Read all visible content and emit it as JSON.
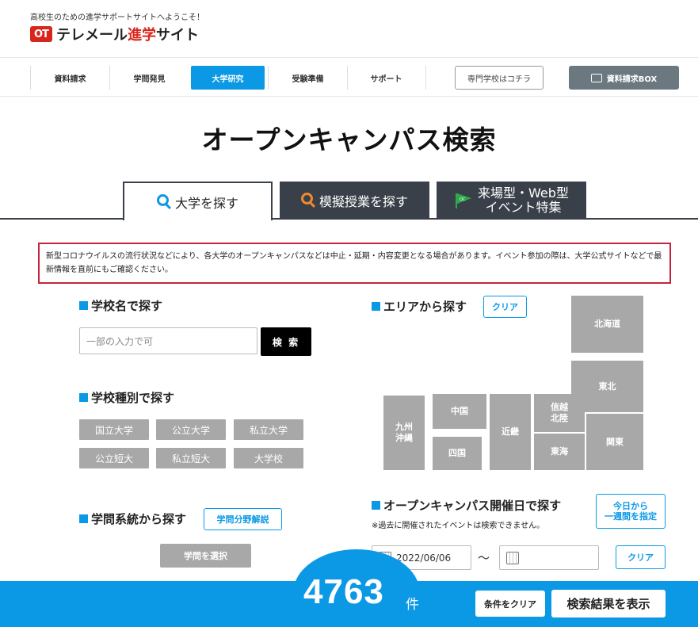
{
  "header": {
    "tagline": "高校生のための進学サポートサイトへようこそ！",
    "logo_mark": "OT",
    "logo_text_a": "テレメール",
    "logo_text_b": "進学",
    "logo_text_c": "サイト"
  },
  "nav": {
    "items": [
      {
        "label": "資料請求"
      },
      {
        "label": "学問発見"
      },
      {
        "label": "大学研究",
        "active": true
      },
      {
        "label": "受験準備"
      },
      {
        "label": "サポート"
      }
    ],
    "senmon_link": "専門学校はコチラ",
    "request_box": "資料請求BOX"
  },
  "page_title": "オープンキャンパス検索",
  "tabs": {
    "univ": "大学を探す",
    "mogi": "模擬授業を探す",
    "event_line1": "来場型・Web型",
    "event_line2": "イベント特集",
    "event_badge": "OC"
  },
  "notice": "新型コロナウイルスの流行状況などにより、各大学のオープンキャンパスなどは中止・延期・内容変更となる場合があります。イベント参加の際は、大学公式サイトなどで最新情報を直前にもご確認ください。",
  "name_search": {
    "title": "学校名で探す",
    "placeholder": "一部の入力で可",
    "button": "検 索"
  },
  "school_type": {
    "title": "学校種別で探す",
    "options": [
      "国立大学",
      "公立大学",
      "私立大学",
      "公立短大",
      "私立短大",
      "大学校"
    ]
  },
  "field": {
    "title": "学問系統から探す",
    "explain_button": "学問分野解説",
    "select_button": "学問を選択"
  },
  "area": {
    "title": "エリアから探す",
    "clear": "クリア",
    "regions": {
      "hokkaido": "北海道",
      "tohoku": "東北",
      "kanto": "関東",
      "shinetsu_line1": "信越",
      "shinetsu_line2": "北陸",
      "tokai": "東海",
      "kinki": "近畿",
      "chugoku": "中国",
      "shikoku": "四国",
      "kyushu_line1": "九州",
      "kyushu_line2": "沖縄"
    }
  },
  "date": {
    "title": "オープンキャンパス開催日で探す",
    "note": "※過去に開催されたイベントは検索できません。",
    "week_button_line1": "今日から",
    "week_button_line2": "一週間を指定",
    "from": "2022/06/06",
    "to": "",
    "separator": "〜",
    "clear": "クリア"
  },
  "result": {
    "count": "4763",
    "unit": "件",
    "clear_conditions": "条件をクリア",
    "show_results": "検索結果を表示"
  },
  "colors": {
    "accent": "#0b99e6",
    "notice_border": "#c4243b",
    "tab_dark": "#3a4049",
    "logo_red": "#d9261c"
  }
}
